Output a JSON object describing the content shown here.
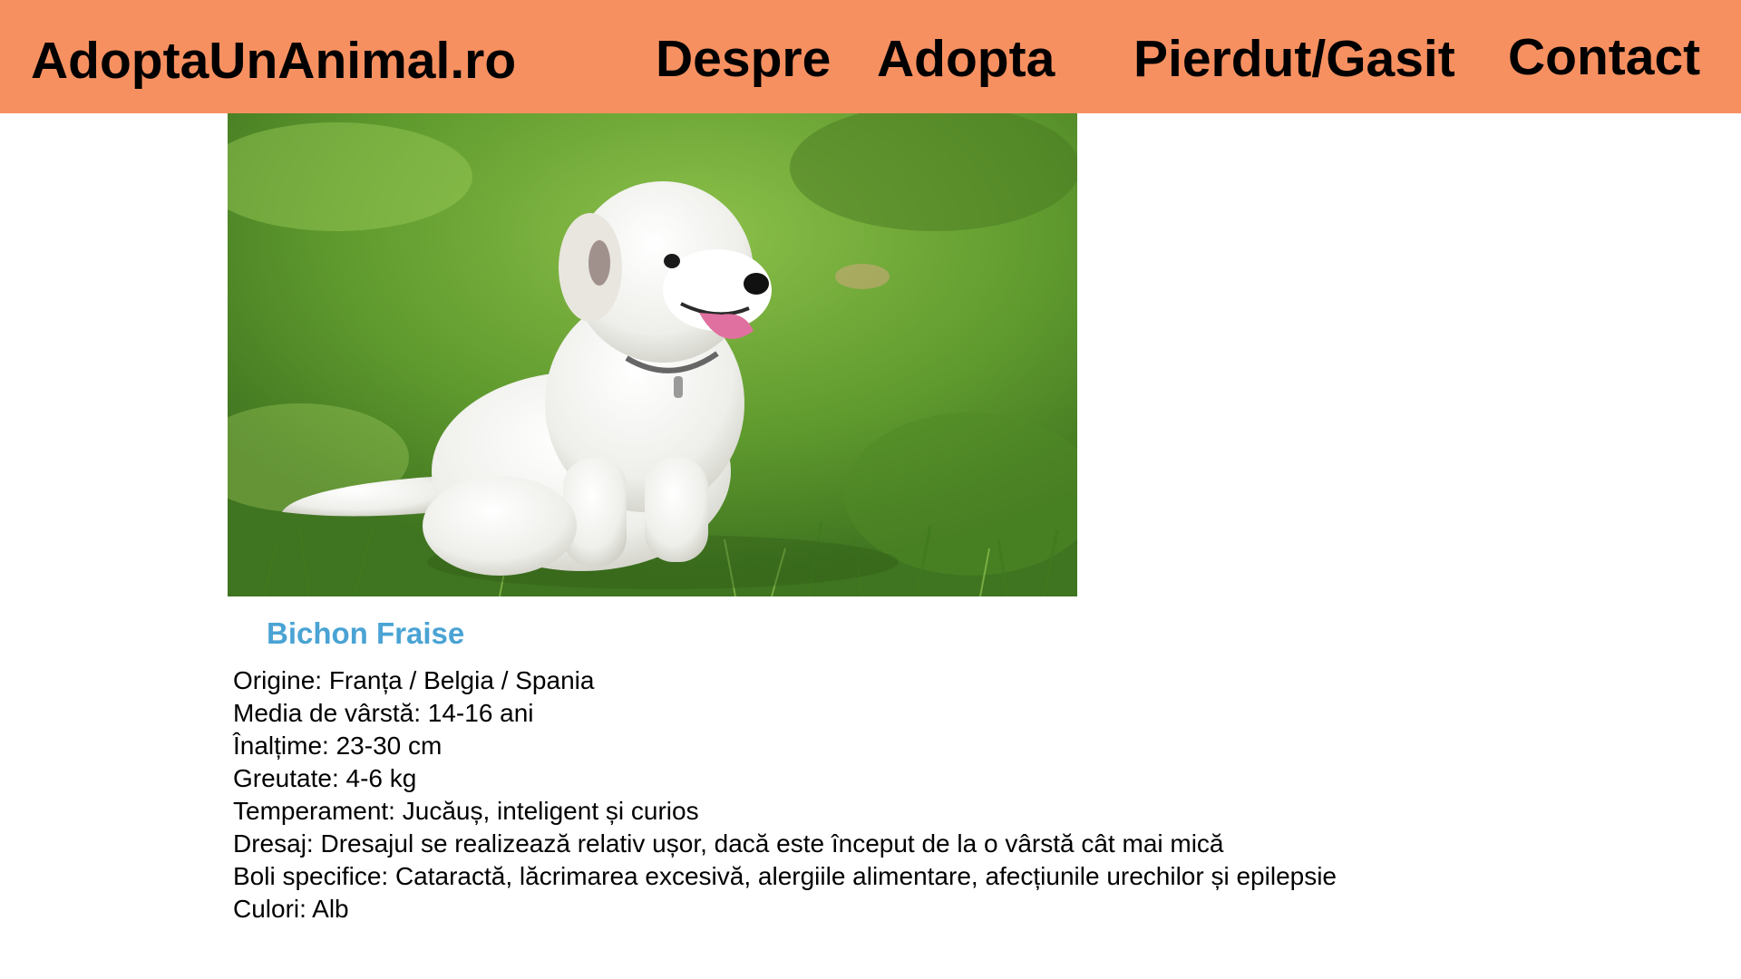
{
  "header": {
    "brand": "AdoptaUnAnimal.ro",
    "nav": [
      "Despre",
      "Adopta",
      "Pierdut/Gasit",
      "Contact"
    ]
  },
  "colors": {
    "header_bg": "#f79060",
    "title": "#4aa3d4"
  },
  "animal": {
    "name": "Bichon Fraise",
    "photo_icon": "white-curly-dog-photo",
    "details": [
      "Origine: Franța / Belgia / Spania",
      "Media de vârstă: 14-16 ani",
      "Înalțime: 23-30 cm",
      "Greutate: 4-6 kg",
      "Temperament: Jucăuș, inteligent și curios",
      "Dresaj: Dresajul se realizează relativ ușor, dacă este început de la o vârstă cât mai mică",
      "Boli specifice: Cataractă, lăcrimarea excesivă, alergiile alimentare, afecțiunile urechilor și epilepsie",
      "Culori: Alb"
    ]
  }
}
